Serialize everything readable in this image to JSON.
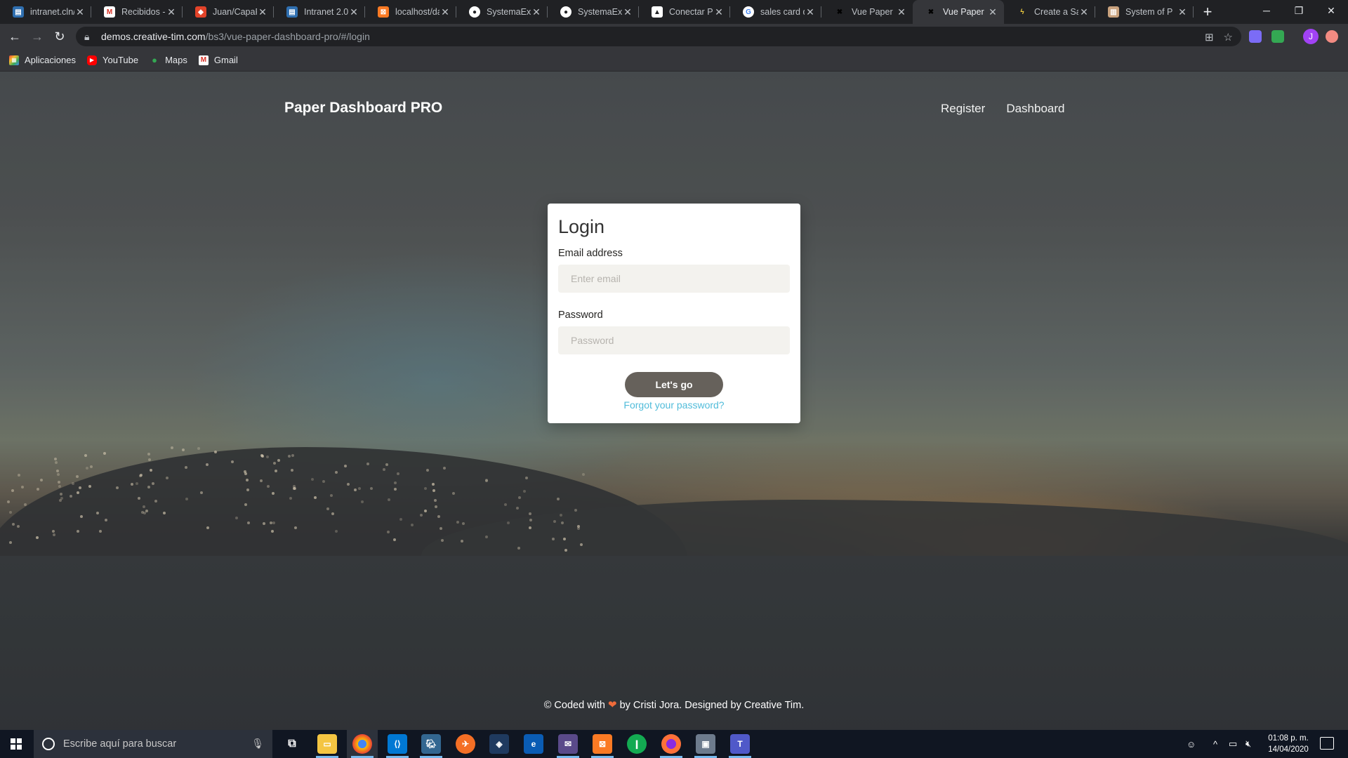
{
  "browser": {
    "tabs": [
      {
        "title": "intranet.cln/",
        "icon": "intranet-favicon",
        "color": "#2f6fb0"
      },
      {
        "title": "Recibidos - j",
        "icon": "gmail-favicon",
        "color": "#d93025"
      },
      {
        "title": "Juan/CapaPr",
        "icon": "gitlab-favicon",
        "color": "#e24329"
      },
      {
        "title": "Intranet 2.0",
        "icon": "intranet-favicon",
        "color": "#2f6fb0"
      },
      {
        "title": "localhost/da",
        "icon": "xampp-favicon",
        "color": "#fb7a24"
      },
      {
        "title": "SystemaExh",
        "icon": "github-favicon",
        "color": "#ffffff"
      },
      {
        "title": "SystemaExh",
        "icon": "github-favicon",
        "color": "#ffffff"
      },
      {
        "title": "Conectar Po",
        "icon": "page-favicon",
        "color": "#ffffff"
      },
      {
        "title": "sales card d",
        "icon": "google-favicon",
        "color": "#ffffff"
      },
      {
        "title": "Vue Paper D",
        "icon": "creative-tim-favicon",
        "color": "#000000"
      },
      {
        "title": "Vue Paper D",
        "icon": "creative-tim-favicon",
        "color": "#000000",
        "active": true
      },
      {
        "title": "Create a Sal",
        "icon": "lightning-favicon",
        "color": "#f4d03f"
      },
      {
        "title": "System of P",
        "icon": "document-favicon",
        "color": "#c9a27e"
      }
    ],
    "address": {
      "host": "demos.creative-tim.com",
      "path": "/bs3/vue-paper-dashboard-pro/#/login"
    },
    "profile_initial": "J",
    "bookmarks": [
      {
        "label": "Aplicaciones",
        "icon": "apps-grid-icon",
        "color": "#e8453c"
      },
      {
        "label": "YouTube",
        "icon": "youtube-icon",
        "color": "#ff0000"
      },
      {
        "label": "Maps",
        "icon": "maps-pin-icon",
        "color": "#34a853"
      },
      {
        "label": "Gmail",
        "icon": "gmail-icon",
        "color": "#d93025"
      }
    ]
  },
  "page": {
    "brand": "Paper Dashboard PRO",
    "nav": [
      "Register",
      "Dashboard"
    ],
    "login": {
      "title": "Login",
      "email_label": "Email address",
      "email_placeholder": "Enter email",
      "password_label": "Password",
      "password_placeholder": "Password",
      "submit_label": "Let's go",
      "forgot_label": "Forgot your password?"
    },
    "footer": {
      "prefix": "© Coded with",
      "heart": "❤",
      "suffix": "by Cristi Jora. Designed by Creative Tim."
    },
    "colors": {
      "button": "#66615b",
      "link": "#51bcda",
      "heart": "#ef6b3a"
    }
  },
  "taskbar": {
    "search_placeholder": "Escribe aquí para buscar",
    "time": "01:08 p. m.",
    "date": "14/04/2020"
  }
}
